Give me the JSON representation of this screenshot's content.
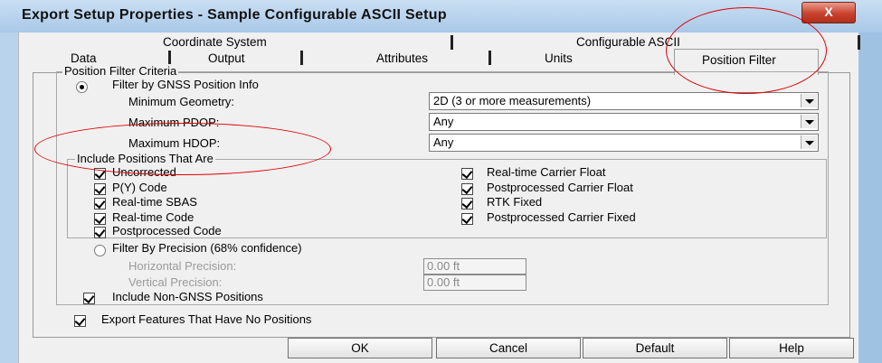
{
  "window": {
    "title": "Export Setup Properties - Sample Configurable ASCII Setup",
    "close_label": "X"
  },
  "tabs": {
    "row1": [
      "Coordinate System",
      "Configurable ASCII"
    ],
    "row2": [
      "Data",
      "Output",
      "Attributes",
      "Units",
      "Position Filter"
    ],
    "active": "Position Filter"
  },
  "criteria": {
    "group_label": "Position Filter Criteria",
    "filter_gnss_label": "Filter by GNSS Position Info",
    "filter_gnss_selected": true,
    "min_geometry_label": "Minimum Geometry:",
    "min_geometry_value": "2D (3 or more measurements)",
    "max_pdop_label": "Maximum PDOP:",
    "max_pdop_value": "Any",
    "max_hdop_label": "Maximum HDOP:",
    "max_hdop_value": "Any"
  },
  "include": {
    "group_label": "Include Positions That Are",
    "left": [
      {
        "label": "Uncorrected",
        "checked": true
      },
      {
        "label": "P(Y) Code",
        "checked": true
      },
      {
        "label": "Real-time SBAS",
        "checked": true
      },
      {
        "label": "Real-time Code",
        "checked": true
      },
      {
        "label": "Postprocessed Code",
        "checked": true
      }
    ],
    "right": [
      {
        "label": "Real-time Carrier Float",
        "checked": true
      },
      {
        "label": "Postprocessed Carrier Float",
        "checked": true
      },
      {
        "label": "RTK Fixed",
        "checked": true
      },
      {
        "label": "Postprocessed Carrier Fixed",
        "checked": true
      }
    ]
  },
  "precision": {
    "filter_label": "Filter By Precision (68% confidence)",
    "selected": false,
    "horizontal_label": "Horizontal Precision:",
    "horizontal_value": "0.00 ft",
    "vertical_label": "Vertical Precision:",
    "vertical_value": "0.00 ft"
  },
  "include_non_gnss": {
    "label": "Include Non-GNSS Positions",
    "checked": true
  },
  "export_no_positions": {
    "label": "Export Features That Have No Positions",
    "checked": true
  },
  "buttons": {
    "ok": "OK",
    "cancel": "Cancel",
    "default": "Default",
    "help": "Help"
  },
  "colors": {
    "annotation": "#e00000",
    "title_bar": "#a9c8e8",
    "dialog_bg": "#f0f0f0"
  }
}
